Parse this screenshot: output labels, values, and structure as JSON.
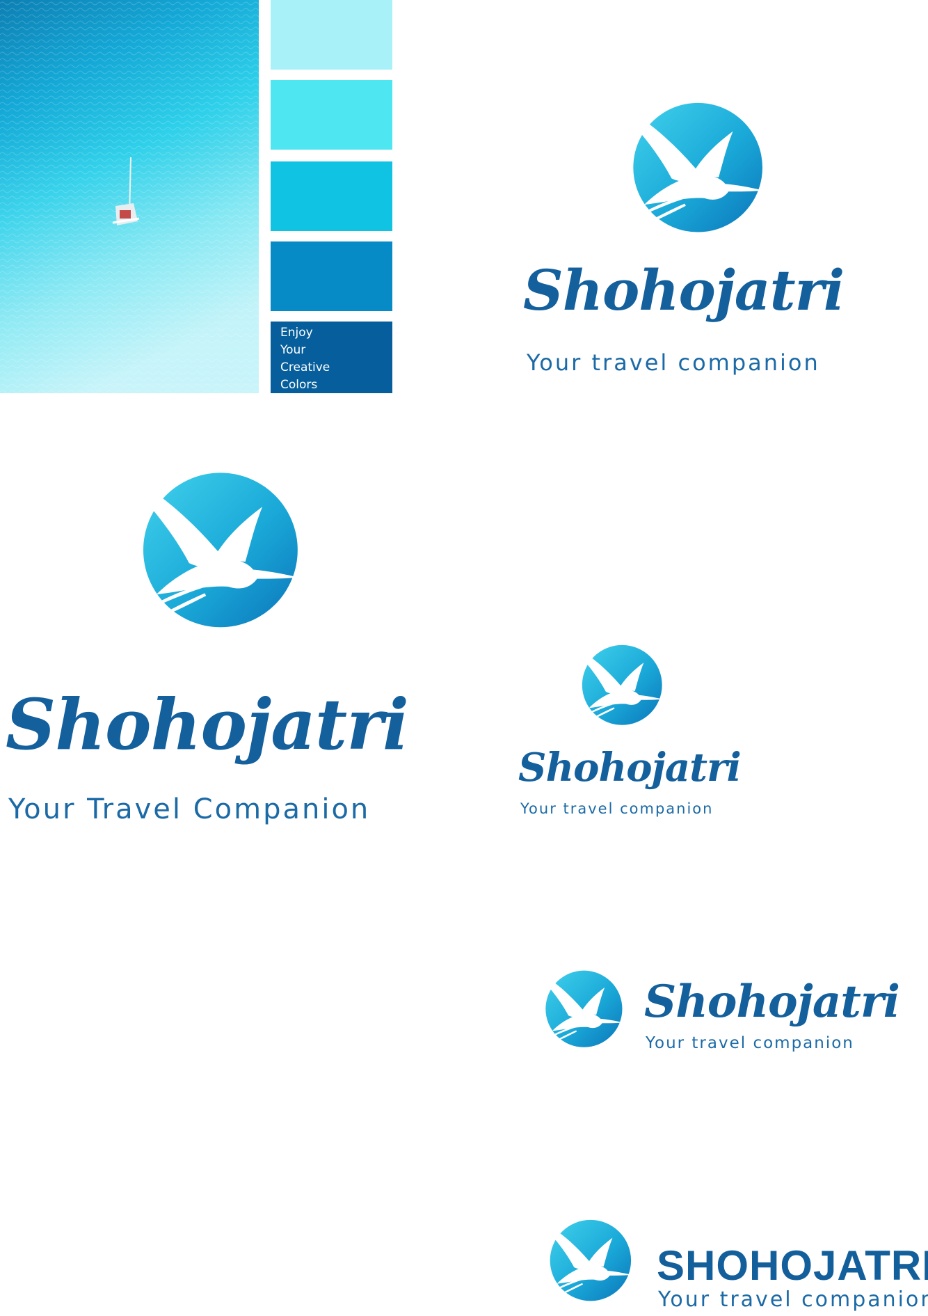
{
  "palette": {
    "swatches": [
      {
        "color": "#a9f1f8",
        "label": ""
      },
      {
        "color": "#4ee6f0",
        "label": ""
      },
      {
        "color": "#10c3e2",
        "label": ""
      },
      {
        "color": "#068bc6",
        "label": ""
      },
      {
        "color": "#065f9c",
        "label": "Enjoy Your Creative Colors",
        "lines": [
          "Enjoy",
          "Your",
          "Creative",
          "Colors"
        ]
      }
    ]
  },
  "brand": {
    "name": "Shohojatri",
    "name_caps": "SHOHOJATRI",
    "tagline": "Your travel companion",
    "tagline_title": "Your Travel Companion",
    "primary_color": "#14609d",
    "icon": "heron-in-circle-icon"
  }
}
